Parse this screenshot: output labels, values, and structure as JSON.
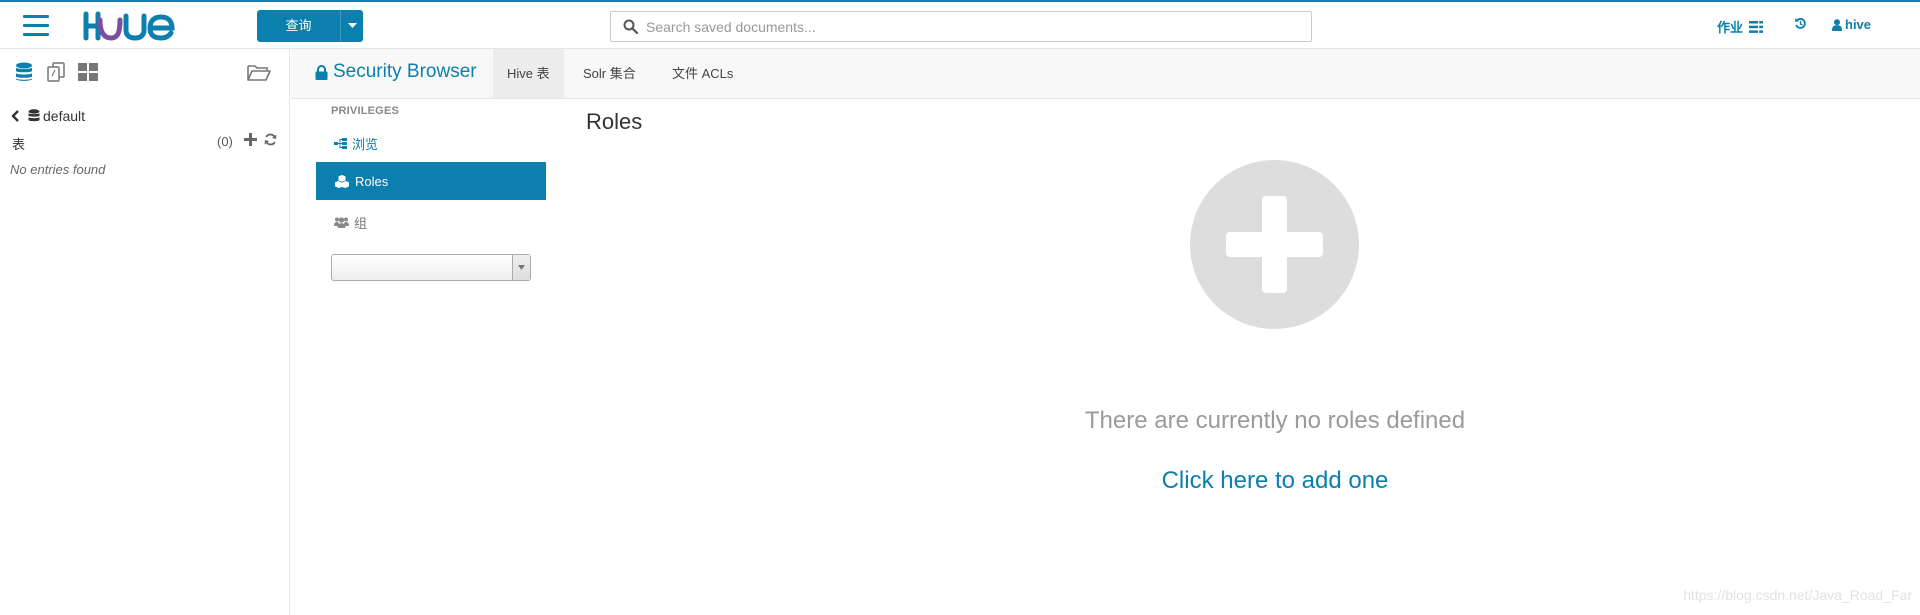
{
  "navbar": {
    "logo_text": "HUE",
    "query_button": "查询",
    "search": {
      "placeholder": "Search saved documents..."
    },
    "jobs_label": "作业",
    "user_label": "hive",
    "icons": [
      "hamburger-menu-icon",
      "search-icon",
      "jobs-list-icon",
      "history-icon",
      "user-icon"
    ]
  },
  "assist": {
    "icons": [
      "database-icon",
      "documents-icon",
      "dashboard-icon",
      "folder-open-icon"
    ],
    "database": "default",
    "tables_label": "表",
    "tables_count": "(0)",
    "empty_text": "No entries found"
  },
  "app": {
    "title": "Security Browser",
    "tabs": [
      {
        "label": "Hive 表",
        "active": true
      },
      {
        "label": "Solr 集合",
        "active": false
      },
      {
        "label": "文件 ACLs",
        "active": false
      }
    ]
  },
  "sidebar": {
    "header": "PRIVILEGES",
    "items": [
      {
        "label": "浏览",
        "icon": "sitemap-icon"
      },
      {
        "label": "Roles",
        "icon": "cubes-icon",
        "active": true
      },
      {
        "label": "组",
        "icon": "users-icon"
      }
    ],
    "group_select_value": ""
  },
  "main": {
    "title": "Roles",
    "empty_message": "There are currently no roles defined",
    "add_link": "Click here to add one"
  },
  "watermark": "https://blog.csdn.net/Java_Road_Far",
  "colors": {
    "accent": "#0b7fad",
    "placeholder_circle": "#dddddd",
    "muted_text": "#9a9a9a"
  }
}
